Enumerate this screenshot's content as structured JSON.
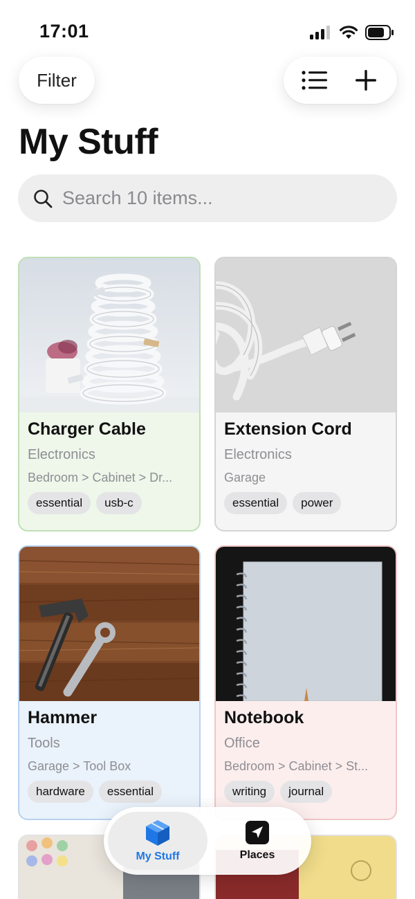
{
  "status": {
    "time": "17:01"
  },
  "toolbar": {
    "filter_label": "Filter"
  },
  "page": {
    "title": "My Stuff"
  },
  "search": {
    "placeholder": "Search 10 items..."
  },
  "items": [
    {
      "title": "Charger Cable",
      "category": "Electronics",
      "location": "Bedroom > Cabinet > Dr...",
      "tags": [
        "essential",
        "usb-c"
      ],
      "tint": "#eef7ea",
      "border": "#bfe0b5"
    },
    {
      "title": "Extension Cord",
      "category": "Electronics",
      "location": "Garage",
      "tags": [
        "essential",
        "power"
      ],
      "tint": "#f5f5f5",
      "border": "#d4d4d4"
    },
    {
      "title": "Hammer",
      "category": "Tools",
      "location": "Garage > Tool Box",
      "tags": [
        "hardware",
        "essential"
      ],
      "tint": "#eaf2fb",
      "border": "#b8d2ee"
    },
    {
      "title": "Notebook",
      "category": "Office",
      "location": "Bedroom > Cabinet > St...",
      "tags": [
        "writing",
        "journal"
      ],
      "tint": "#fdeeee",
      "border": "#f1c6c6"
    }
  ],
  "tabs": [
    {
      "label": "My Stuff",
      "icon": "cube-icon",
      "active": true
    },
    {
      "label": "Places",
      "icon": "location-arrow-icon",
      "active": false
    }
  ],
  "colors": {
    "accent": "#1f77e6"
  }
}
